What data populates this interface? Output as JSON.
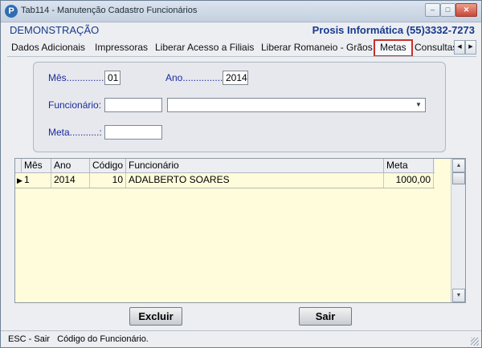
{
  "window": {
    "title": "Tab114 - Manutenção Cadastro Funcionários",
    "app_icon_glyph": "P",
    "controls": {
      "minimize": "–",
      "maximize": "□",
      "close": "✕"
    }
  },
  "header": {
    "company": "DEMONSTRAÇÃO",
    "contact": "Prosis Informática (55)3332-7273"
  },
  "tabs": {
    "items": [
      {
        "label": "Dados Adicionais"
      },
      {
        "label": "Impressoras"
      },
      {
        "label": "Liberar Acesso a Filiais"
      },
      {
        "label": "Liberar Romaneio - Grãos"
      },
      {
        "label": "Metas",
        "active": true
      },
      {
        "label": "Consultas"
      }
    ],
    "scroll_left": "◀",
    "scroll_right": "▶"
  },
  "form": {
    "mes_label": "Mês...............:",
    "mes_value": "01",
    "ano_label": "Ano...............:",
    "ano_value": "2014",
    "funcionario_label": "Funcionário:",
    "funcionario_code_value": "",
    "funcionario_name_value": "",
    "combo_arrow": "▼",
    "meta_label": "Meta...........:",
    "meta_value": ""
  },
  "grid": {
    "columns": [
      "Mês",
      "Ano",
      "Código",
      "Funcionário",
      "Meta"
    ],
    "rows": [
      {
        "indicator": "▶",
        "mes": "1",
        "ano": "2014",
        "codigo": "10",
        "funcionario": "ADALBERTO SOARES",
        "meta": "1000,00"
      }
    ],
    "scroll_up": "▲",
    "scroll_down": "▼"
  },
  "buttons": {
    "delete": "Excluir",
    "exit": "Sair"
  },
  "status_bar": {
    "text": "ESC - Sair   Código do Funcionário."
  },
  "colors": {
    "accent": "#173a8c",
    "label": "#1a2b9b",
    "grid_background": "#fffcdc",
    "active_tab_border": "#c8322d"
  }
}
